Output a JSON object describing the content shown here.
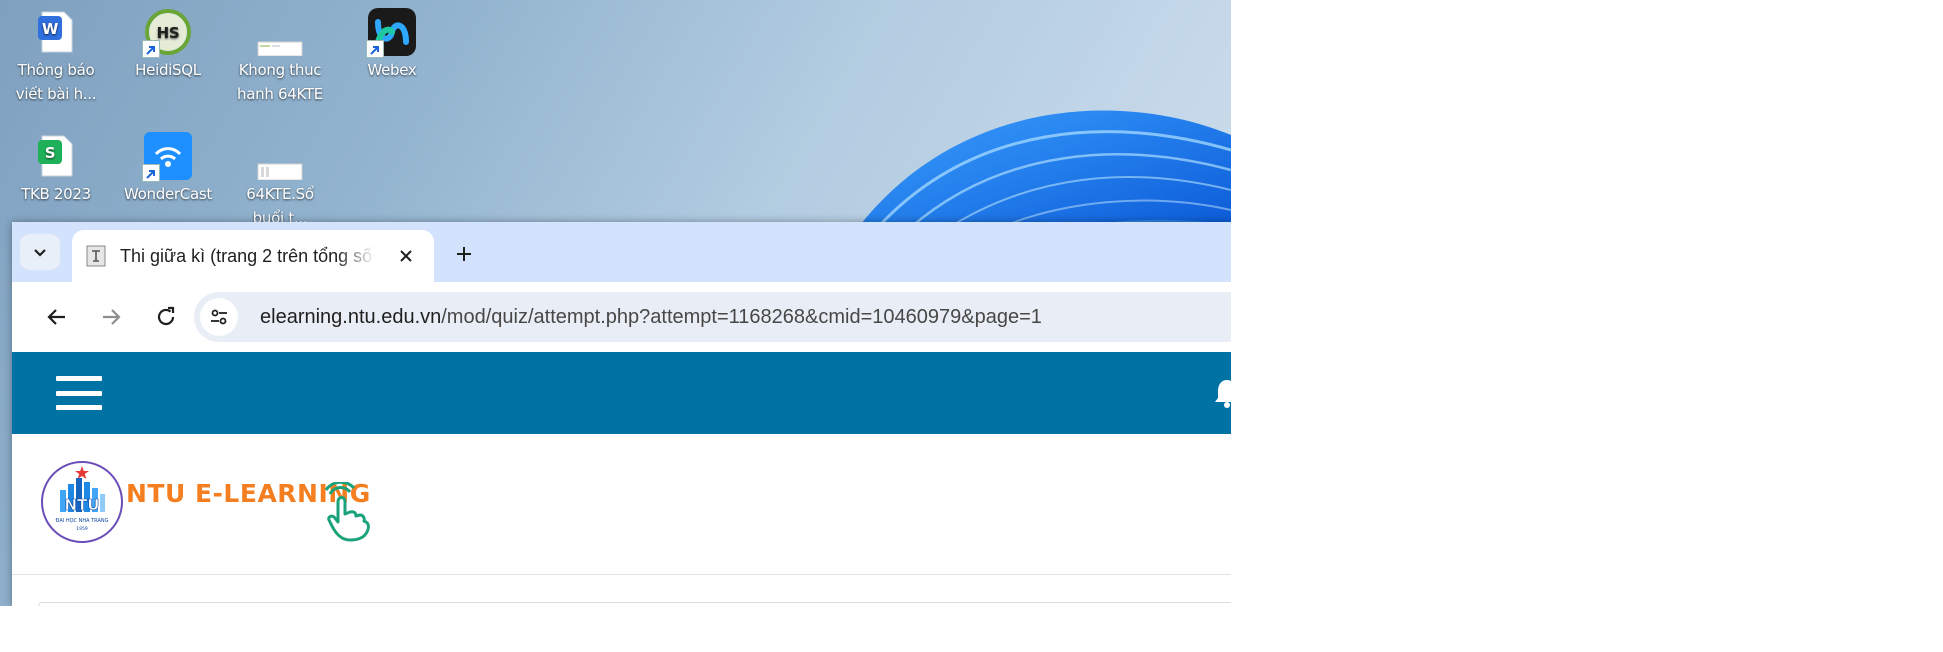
{
  "desktop": {
    "icons": [
      {
        "label": "Thông báo\nviết bài h...",
        "icon": "wps-writer-document-icon",
        "color": "#2f6fde"
      },
      {
        "label": "HeidiSQL",
        "icon": "heidisql-icon",
        "color": "#6aa53a"
      },
      {
        "label": "Khong thuc\nhanh 64KTE",
        "icon": "spreadsheet-file-thumbnail-icon",
        "color": "#ffffff"
      },
      {
        "label": "Webex",
        "icon": "webex-icon",
        "color": "#1a1a1a"
      },
      {
        "label": "TKB 2023",
        "icon": "wps-spreadsheet-icon",
        "color": "#1fb15a"
      },
      {
        "label": "WonderCast",
        "icon": "wondercast-wifi-icon",
        "color": "#1e8fff"
      },
      {
        "label": "64KTE.Sổ\nbuổi t...",
        "icon": "spreadsheet-file-thumbnail-icon",
        "color": "#ffffff"
      }
    ]
  },
  "browser": {
    "tab": {
      "title": "Thi giữa kì (trang 2 trên tổng số"
    },
    "address": {
      "host": "elearning.ntu.edu.vn",
      "path": "/mod/quiz/attempt.php?attempt=1168268&cmid=10460979&page=1"
    }
  },
  "site": {
    "navbar_color": "#0072a4",
    "name": "NTU E-LEARNING",
    "brand_color": "#f57f20",
    "seal": {
      "abbr": "NTU",
      "caption": "ĐẠI HỌC NHA TRANG",
      "year": "1959"
    }
  }
}
